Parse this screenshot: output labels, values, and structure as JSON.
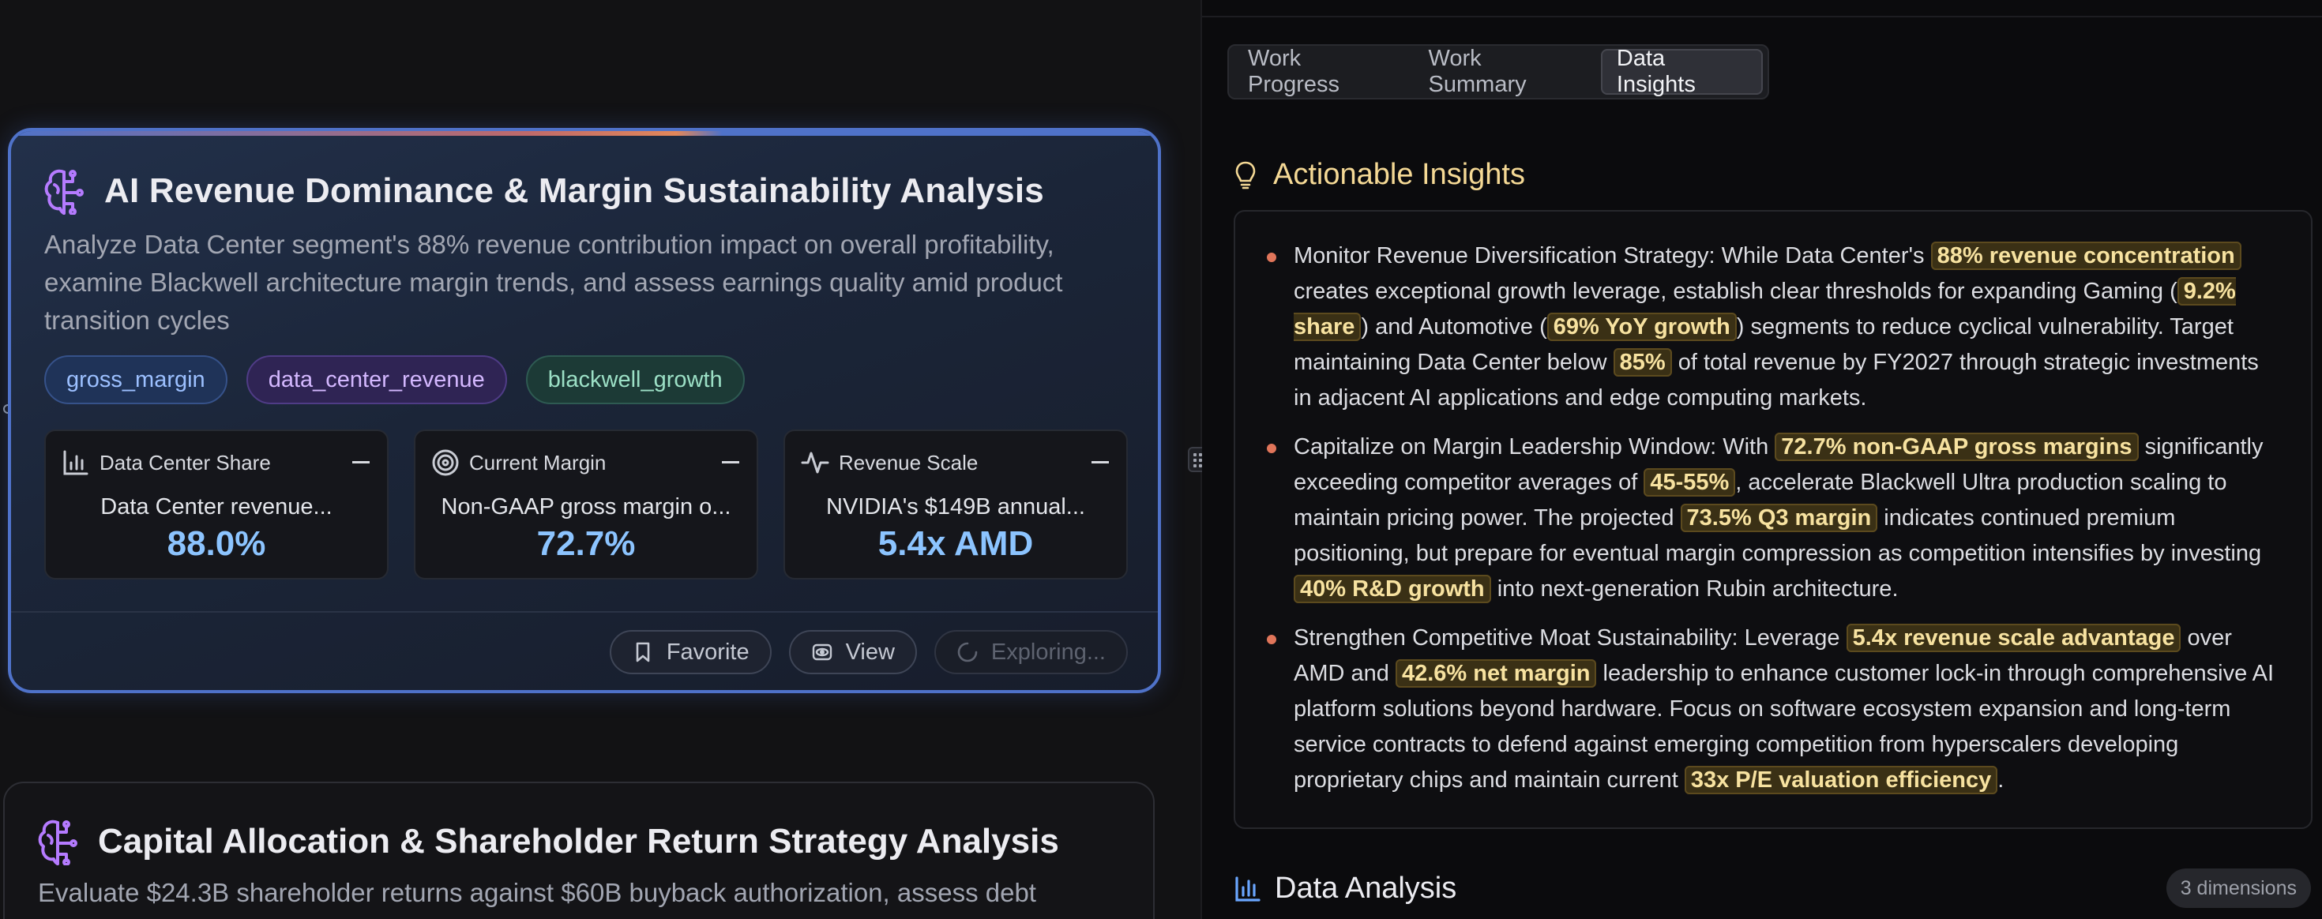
{
  "left": {
    "card1": {
      "title": "AI Revenue Dominance & Margin Sustainability Analysis",
      "description": "Analyze Data Center segment's 88% revenue contribution impact on overall profitability, examine Blackwell architecture margin trends, and assess earnings quality amid product transition cycles",
      "tags": [
        "gross_margin",
        "data_center_revenue",
        "blackwell_growth"
      ],
      "metrics": [
        {
          "label": "Data Center Share",
          "subtitle": "Data Center revenue...",
          "value": "88.0%"
        },
        {
          "label": "Current Margin",
          "subtitle": "Non-GAAP gross margin o...",
          "value": "72.7%"
        },
        {
          "label": "Revenue Scale",
          "subtitle": "NVIDIA's $149B annual...",
          "value": "5.4x AMD"
        }
      ],
      "actions": {
        "favorite": "Favorite",
        "view": "View",
        "exploring": "Exploring..."
      }
    },
    "card2": {
      "title": "Capital Allocation & Shareholder Return Strategy Analysis",
      "description": "Evaluate $24.3B shareholder returns against $60B buyback authorization, assess debt"
    }
  },
  "right": {
    "tabs": [
      "Work Progress",
      "Work Summary",
      "Data Insights"
    ],
    "active_tab": "Data Insights",
    "insights_title": "Actionable Insights",
    "insights": [
      {
        "t1": "Monitor Revenue Diversification Strategy: While Data Center's ",
        "h1": "88% revenue concentration",
        "t2": " creates exceptional growth leverage, establish clear thresholds for expanding Gaming (",
        "h2": "9.2% share",
        "t3": ") and Automotive (",
        "h3": "69% YoY growth",
        "t4": ") segments to reduce cyclical vulnerability. Target maintaining Data Center below ",
        "h4": "85%",
        "t5": " of total revenue by FY2027 through strategic investments in adjacent AI applications and edge computing markets."
      },
      {
        "t1": "Capitalize on Margin Leadership Window: With ",
        "h1": "72.7% non-GAAP gross margins",
        "t2": " significantly exceeding competitor averages of ",
        "h2": "45-55%",
        "t3": ", accelerate Blackwell Ultra production scaling to maintain pricing power. The projected ",
        "h3": "73.5% Q3 margin",
        "t4": " indicates continued premium positioning, but prepare for eventual margin compression as competition intensifies by investing ",
        "h4": "40% R&D growth",
        "t5": " into next-generation Rubin architecture."
      },
      {
        "t1": "Strengthen Competitive Moat Sustainability: Leverage ",
        "h1": "5.4x revenue scale advantage",
        "t2": " over AMD and ",
        "h2": "42.6% net margin",
        "t3": " leadership to enhance customer lock-in through comprehensive AI platform solutions beyond hardware. Focus on software ecosystem expansion and long-term service contracts to defend against emerging competition from hyperscalers developing proprietary chips and maintain current ",
        "h3": "33x P/E valuation efficiency",
        "t4": "."
      }
    ],
    "analysis_title": "Data Analysis",
    "dimensions_badge": "3 dimensions"
  }
}
